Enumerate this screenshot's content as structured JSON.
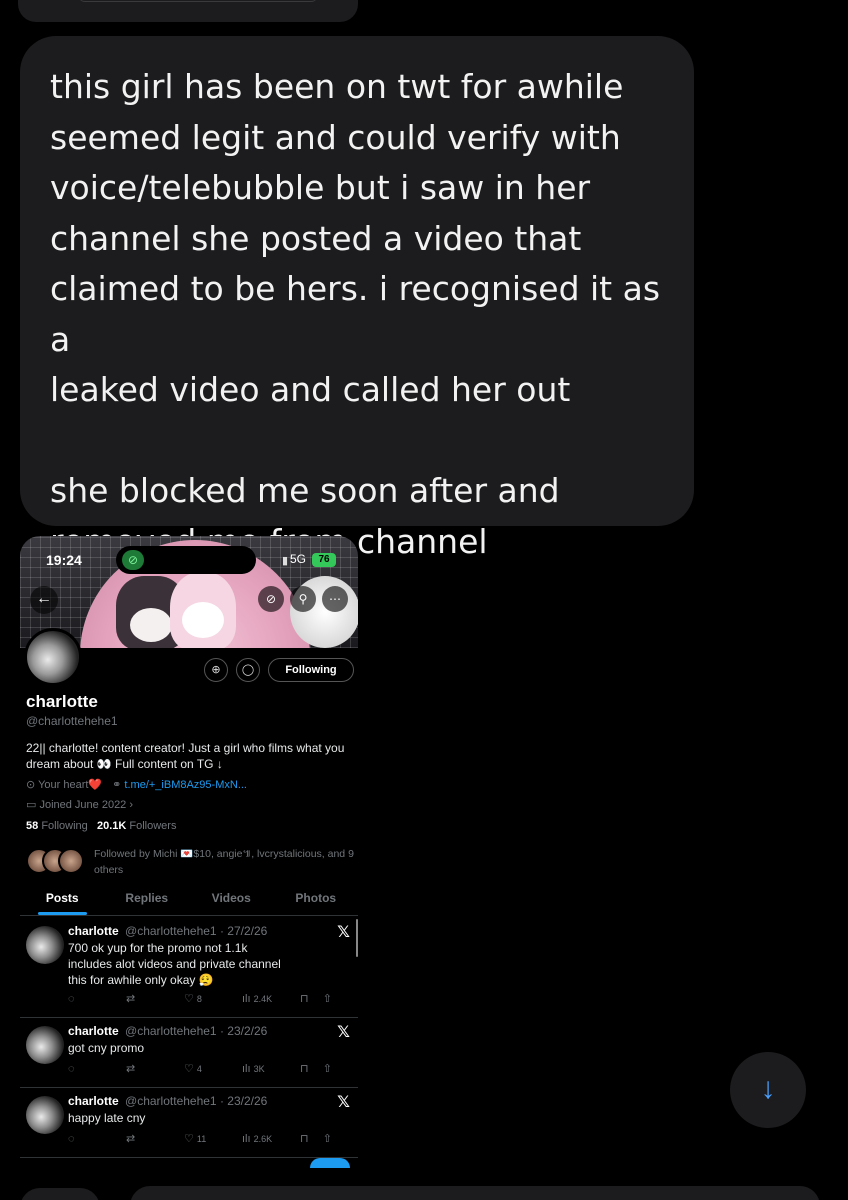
{
  "message": {
    "text": "this girl has been on twt for awhile\nseemed legit and could verify with\nvoice/telebubble but i saw in her\nchannel she posted a video that\nclaimed to be hers. i recognised it as a\nleaked video and called her out\n\nshe blocked me soon after and\nremoved me from channel"
  },
  "screenshot": {
    "status": {
      "time": "19:24",
      "network": "5G",
      "battery": "76"
    },
    "profile": {
      "name": "charlotte",
      "handle": "@charlottehehe1",
      "bio": "22|| charlotte! content creator! Just a girl who films what you dream about 👀 Full content on TG ↓",
      "location": "Your heart❤️",
      "link": "t.me/+_iBM8Az95-MxN...",
      "joined": "Joined June 2022",
      "following_count": "58",
      "following_label": "Following",
      "followers_count": "20.1K",
      "followers_label": "Followers",
      "followed_by": "Followed by Michi 💌$10, angie៕, lvcrystalicious, and 9 others",
      "follow_button": "Following"
    },
    "tabs": [
      "Posts",
      "Replies",
      "Videos",
      "Photos"
    ],
    "posts": [
      {
        "name": "charlotte",
        "handle_date": "@charlottehehe1 · 27/2/26",
        "text": "700 ok yup for the promo not 1.1k\nincludes alot videos and private channel\nthis for awhile only okay 😮‍💨",
        "likes": "8",
        "views": "2.4K"
      },
      {
        "name": "charlotte",
        "handle_date": "@charlottehehe1 · 23/2/26",
        "text": "got cny promo",
        "likes": "4",
        "views": "3K"
      },
      {
        "name": "charlotte",
        "handle_date": "@charlottehehe1 · 23/2/26",
        "text": "happy late cny",
        "likes": "11",
        "views": "2.6K"
      }
    ]
  },
  "icons": {
    "back": "←",
    "scroll_down": "↓",
    "x_logo": "𝕏"
  },
  "colors": {
    "bubble": "#1c1c1e",
    "accent": "#1d9bf0",
    "ios_blue": "#4a9df8"
  }
}
